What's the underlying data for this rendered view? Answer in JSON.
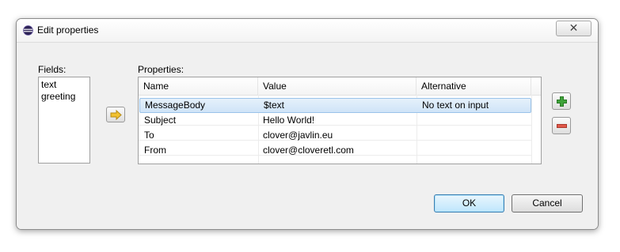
{
  "window": {
    "title": "Edit properties",
    "close_glyph": "✕",
    "icon": "eclipse-icon"
  },
  "fields": {
    "label": "Fields:",
    "items": [
      "text",
      "greeting"
    ]
  },
  "add_field_button": {
    "icon": "arrow-right-icon"
  },
  "properties": {
    "label": "Properties:",
    "columns": [
      "Name",
      "Value",
      "Alternative"
    ],
    "rows": [
      {
        "name": "MessageBody",
        "value": "$text",
        "alternative": "No text on input",
        "selected": true
      },
      {
        "name": "Subject",
        "value": "Hello World!",
        "alternative": ""
      },
      {
        "name": "To",
        "value": "clover@javlin.eu",
        "alternative": ""
      },
      {
        "name": "From",
        "value": "clover@cloveretl.com",
        "alternative": ""
      }
    ]
  },
  "side_buttons": {
    "add_icon": "plus-icon",
    "remove_icon": "minus-icon"
  },
  "buttons": {
    "ok_label": "OK",
    "cancel_label": "Cancel"
  },
  "colors": {
    "selection": "#cfe4f8",
    "plus_green": "#3fa33a",
    "minus_red": "#e0584a",
    "arrow_yellow": "#f2c230"
  }
}
